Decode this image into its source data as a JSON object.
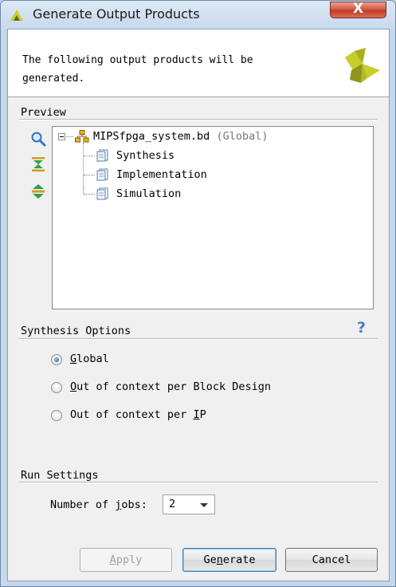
{
  "window": {
    "title": "Generate Output Products",
    "close_label": "X"
  },
  "header": {
    "line1": "The following output products will be",
    "line2": "generated."
  },
  "preview": {
    "label": "Preview",
    "tree": {
      "root": {
        "name": "MIPSfpga_system.bd",
        "scope": "(Global)"
      },
      "children": [
        "Synthesis",
        "Implementation",
        "Simulation"
      ]
    },
    "tools": [
      "search-icon",
      "collapse-all-icon",
      "expand-all-icon"
    ]
  },
  "synthesis_options": {
    "label": "Synthesis Options",
    "help": "?",
    "options": [
      {
        "pre": "",
        "mnemonic": "G",
        "post": "lobal",
        "checked": true
      },
      {
        "pre": "",
        "mnemonic": "O",
        "post": "ut of context per Block Design",
        "checked": false
      },
      {
        "pre": "Out of context per ",
        "mnemonic": "I",
        "post": "P",
        "checked": false
      }
    ]
  },
  "run_settings": {
    "label": "Run Settings",
    "jobs_label_pre": "Number of ",
    "jobs_label_mnemonic": "j",
    "jobs_label_post": "obs:",
    "jobs_value": "2"
  },
  "buttons": {
    "apply_m": "A",
    "apply_rest": "pply",
    "generate_pre": "Ge",
    "generate_m": "n",
    "generate_post": "erate",
    "cancel": "Cancel"
  },
  "colors": {
    "accent": "#3c7fb1",
    "logo": "#c2c72a"
  }
}
